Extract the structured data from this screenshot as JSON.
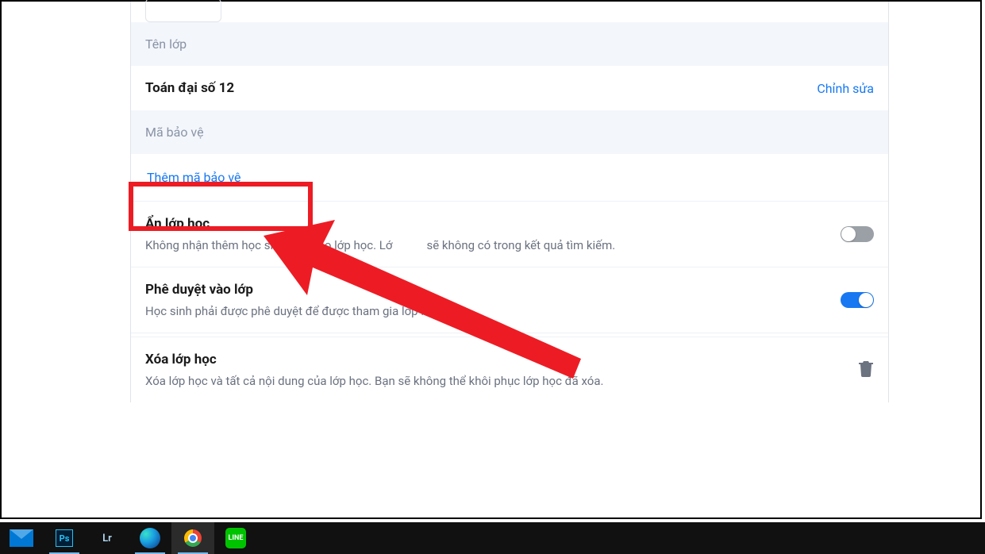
{
  "sections": {
    "class_name_header": "Tên lớp",
    "class_name_value": "Toán đại số 12",
    "edit_link": "Chỉnh sửa",
    "security_code_header": "Mã bảo vệ",
    "add_security_code": "Thêm mã bảo vệ"
  },
  "settings": {
    "hide_class": {
      "title": "Ẩn lớp học",
      "desc_part1": "Không nhận thêm học sinh mới vào lớp học. Lớ",
      "desc_part2": "sẽ không có trong kết quả tìm kiếm."
    },
    "approve_join": {
      "title": "Phê duyệt vào lớp",
      "desc": "Học sinh phải được phê duyệt để được tham gia lớp học này."
    },
    "delete_class": {
      "title": "Xóa lớp học",
      "desc": "Xóa lớp học và tất cả nội dung của lớp học. Bạn sẽ không thể khôi phục lớp học đã xóa."
    }
  },
  "taskbar": {
    "ps": "Ps",
    "lr": "Lr",
    "line": "LINE"
  }
}
